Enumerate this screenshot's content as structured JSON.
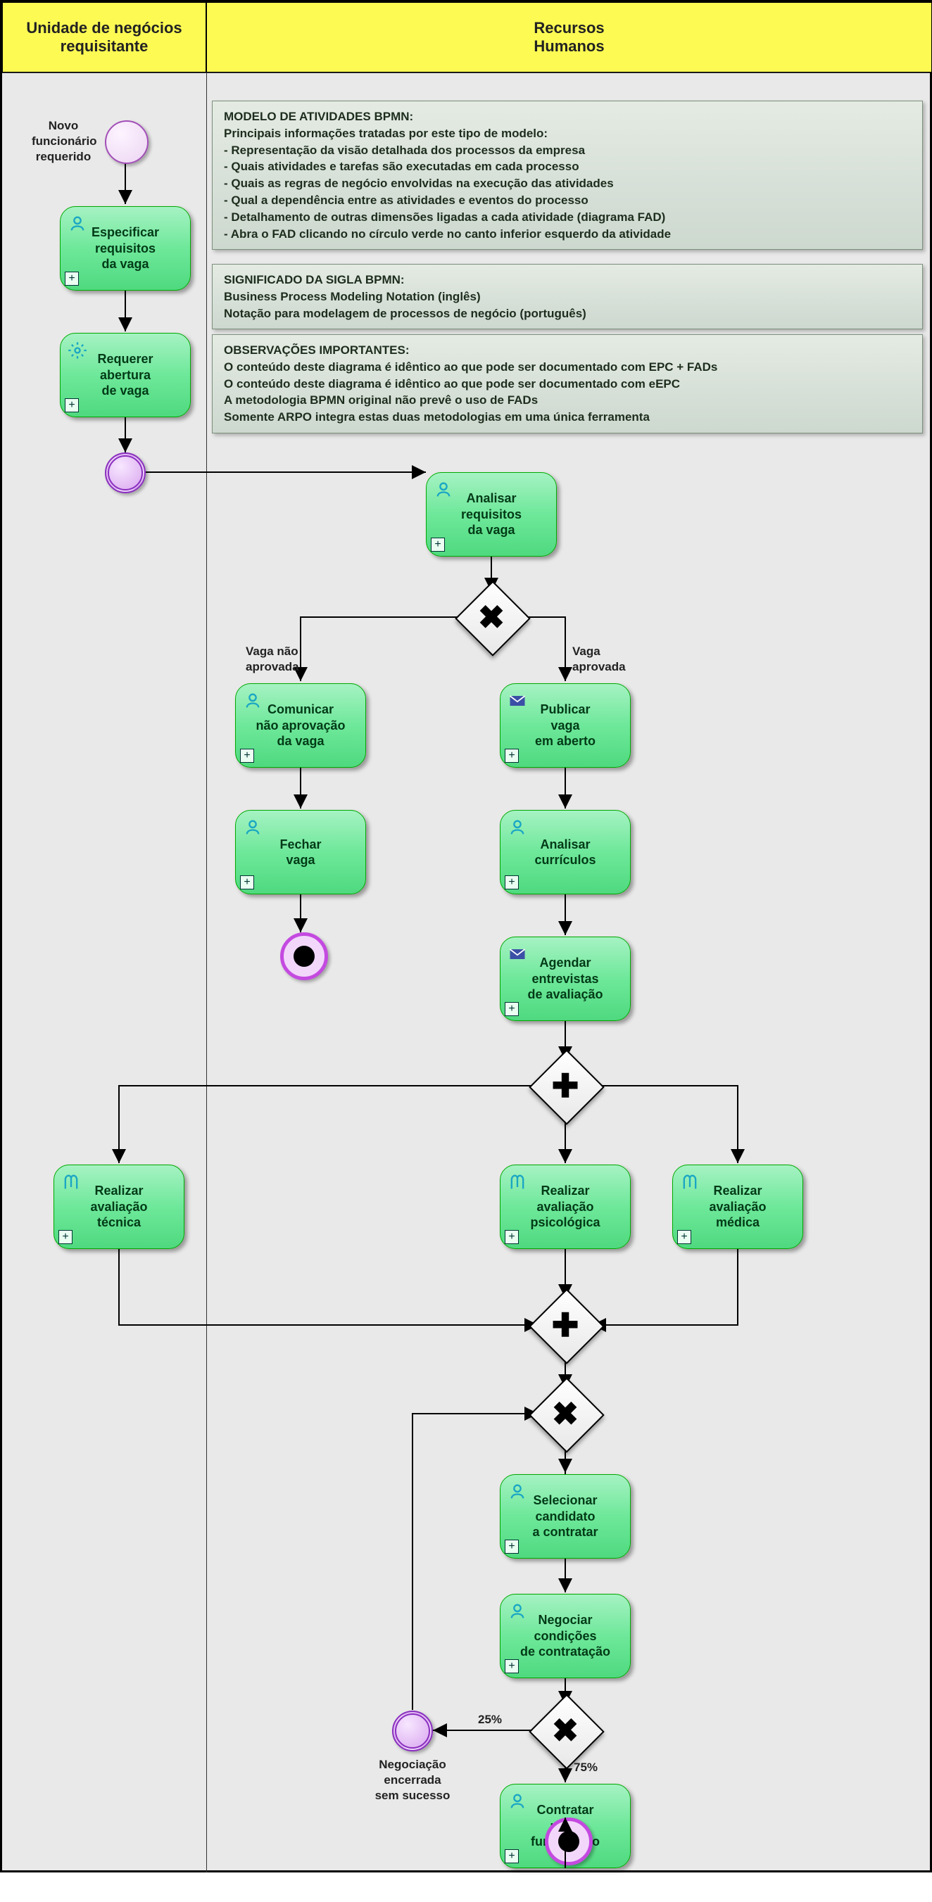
{
  "lanes": {
    "left": "Unidade de negócios\nrequisitante",
    "right": "Recursos\nHumanos"
  },
  "startLabel": "Novo\nfuncionário\nrequerido",
  "tasks": {
    "t1": "Especificar\nrequisitos\nda vaga",
    "t2": "Requerer\nabertura\nde vaga",
    "t3": "Analisar\nrequisitos\nda vaga",
    "t4": "Comunicar\nnão aprovação\nda vaga",
    "t5": "Fechar\nvaga",
    "t6": "Publicar\nvaga\nem aberto",
    "t7": "Analisar\ncurrículos",
    "t8": "Agendar\nentrevistas\nde avaliação",
    "t9": "Realizar\navaliação\ntécnica",
    "t10": "Realizar\navaliação\npsicológica",
    "t11": "Realizar\navaliação\nmédica",
    "t12": "Selecionar\ncandidato\na contratar",
    "t13": "Negociar\ncondições\nde contratação",
    "t14": "Contratar\nnovo\nfuncionário"
  },
  "branchLabels": {
    "nao": "Vaga não\naprovada",
    "sim": "Vaga\naprovada"
  },
  "probs": {
    "p25": "25%",
    "p75": "75%"
  },
  "negLabel": "Negociação\nencerrada\nsem sucesso",
  "notes": {
    "n1": {
      "title": "MODELO DE ATIVIDADES BPMN:",
      "sub": "Principais informações tratadas por este tipo de modelo:",
      "b1": "- Representação da visão detalhada dos processos da empresa",
      "b2": "- Quais atividades e tarefas são executadas em cada processo",
      "b3": "- Quais as regras de negócio envolvidas na execução das atividades",
      "b4": "- Qual a dependência entre as atividades e eventos do processo",
      "b5": "- Detalhamento de outras dimensões ligadas a cada atividade (diagrama FAD)",
      "b6": "- Abra o FAD clicando no círculo verde no canto inferior esquerdo da atividade"
    },
    "n2": {
      "title": "SIGNIFICADO DA SIGLA BPMN:",
      "l1": "Business Process Modeling Notation (inglês)",
      "l2": "Notação para modelagem de processos de negócio (português)"
    },
    "n3": {
      "title": "OBSERVAÇÕES IMPORTANTES:",
      "l1": "O conteúdo deste diagrama é idêntico ao que pode ser documentado com EPC + FADs",
      "l2": "O conteúdo deste diagrama é idêntico ao que pode ser documentado com eEPC",
      "l3": "A metodologia BPMN original não prevê o uso de FADs",
      "l4": "Somente ARPO integra estas duas metodologias em uma única ferramenta"
    }
  }
}
